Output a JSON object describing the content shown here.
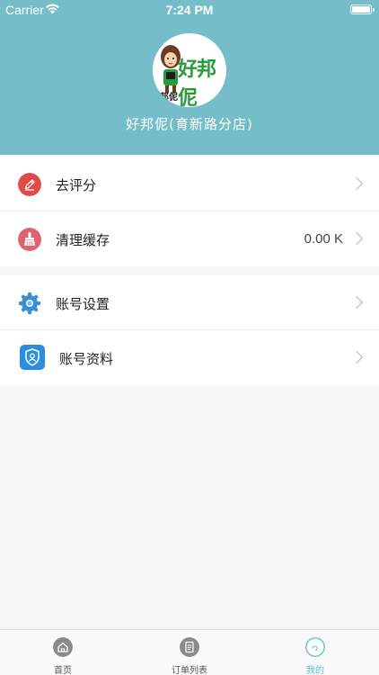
{
  "status_bar": {
    "carrier": "Carrier",
    "time": "7:24 PM"
  },
  "profile": {
    "avatar_logo_text": "好邦伲",
    "avatar_subtext": "邦伲",
    "shop_name": "好邦伲(育新路分店)"
  },
  "menu_group_1": [
    {
      "label": "去评分",
      "value": "",
      "icon": "pencil-icon",
      "icon_color": "#e04a48"
    },
    {
      "label": "清理缓存",
      "value": "0.00 K",
      "icon": "broom-icon",
      "icon_color": "#e0616f"
    }
  ],
  "menu_group_2": [
    {
      "label": "账号设置",
      "value": "",
      "icon": "gear-icon",
      "icon_color": "#3a8fd4"
    },
    {
      "label": "账号资料",
      "value": "",
      "icon": "shield-user-icon",
      "icon_color": "#2b8de0"
    }
  ],
  "tabbar": {
    "tabs": [
      {
        "label": "首页",
        "icon": "home-icon",
        "active": false
      },
      {
        "label": "订单列表",
        "icon": "order-list-icon",
        "active": false
      },
      {
        "label": "我的",
        "icon": "profile-icon",
        "active": true
      }
    ]
  },
  "colors": {
    "header_bg": "#74bdc9",
    "accent": "#5bc1cf"
  }
}
